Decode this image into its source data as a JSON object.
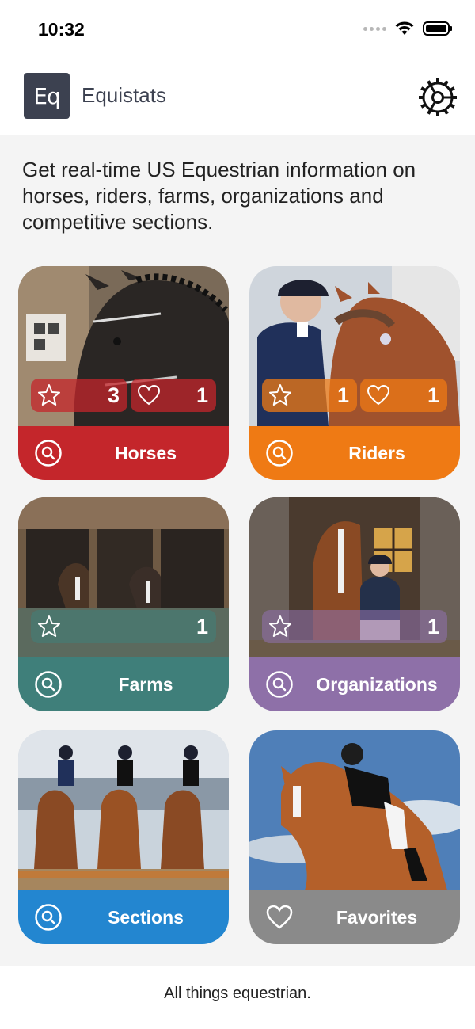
{
  "status_bar": {
    "time": "10:32"
  },
  "app": {
    "logo_text": "Eq",
    "title": "Equistats",
    "settings_icon": "gear-icon"
  },
  "intro_text": "Get real-time US Equestrian information on horses, riders, farms, organizations and competitive sections.",
  "tiles": {
    "horses": {
      "label": "Horses",
      "color": "#c4262b",
      "icon": "search-icon",
      "favorites_count": "3",
      "likes_count": "1"
    },
    "riders": {
      "label": "Riders",
      "color": "#ef7a14",
      "icon": "search-icon",
      "favorites_count": "1",
      "likes_count": "1"
    },
    "farms": {
      "label": "Farms",
      "color": "#3f7f7a",
      "icon": "search-icon",
      "favorites_count": "1"
    },
    "organizations": {
      "label": "Organizations",
      "color": "#8e70a8",
      "icon": "search-icon",
      "favorites_count": "1"
    },
    "sections": {
      "label": "Sections",
      "color": "#2386d0",
      "icon": "search-icon"
    },
    "favorites": {
      "label": "Favorites",
      "color": "#8a8a8a",
      "icon": "heart-icon"
    }
  },
  "footer_text": "All things equestrian."
}
